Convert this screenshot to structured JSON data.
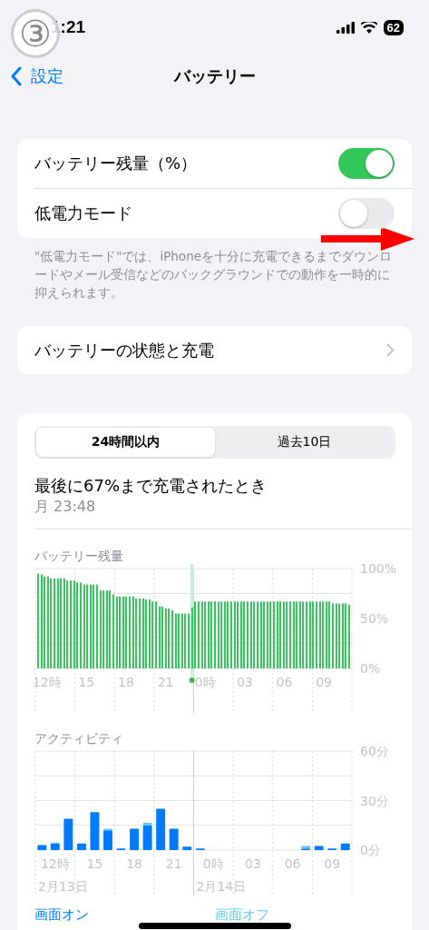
{
  "status_bar": {
    "time": "1:21",
    "battery": "62"
  },
  "annotations": {
    "step_badge": "③",
    "arrow": true
  },
  "nav": {
    "back": "設定",
    "title": "バッテリー"
  },
  "settings": [
    {
      "kind": "toggle",
      "label": "バッテリー残量（%）",
      "on": true
    },
    {
      "kind": "toggle",
      "label": "低電力モード",
      "on": false
    }
  ],
  "footnote": "\"低電力モード\"では、iPhoneを十分に充電できるまでダウンロードやメール受信などのバックグラウンドでの動作を一時的に抑えられます。",
  "health_row": {
    "label": "バッテリーの状態と充電"
  },
  "usage": {
    "tabs": [
      {
        "label": "24時間以内",
        "selected": true
      },
      {
        "label": "過去10日",
        "selected": false
      }
    ],
    "last_charge": {
      "title": "最後に67%まで充電されたとき",
      "time": "月 23:48"
    },
    "battery_chart": {
      "chart_data": {
        "type": "bar",
        "title": "バッテリー残量",
        "values": [
          95,
          94,
          92,
          92,
          90,
          90,
          90,
          90,
          90,
          88,
          88,
          88,
          86,
          86,
          84,
          84,
          84,
          84,
          84,
          78,
          78,
          78,
          78,
          74,
          72,
          72,
          72,
          72,
          72,
          72,
          70,
          70,
          70,
          69,
          69,
          67,
          67,
          62,
          62,
          60,
          60,
          58,
          55,
          55,
          55,
          55,
          55,
          61,
          67,
          67,
          67,
          67,
          67,
          67,
          67,
          67,
          67,
          67,
          67,
          67,
          67,
          67,
          67,
          67,
          67,
          67,
          67,
          67,
          67,
          67,
          67,
          67,
          67,
          67,
          67,
          67,
          67,
          67,
          67,
          67,
          67,
          67,
          67,
          67,
          67,
          67,
          67,
          67,
          67,
          67,
          65,
          65,
          65,
          65,
          65,
          64
        ],
        "categories": [
          null,
          null,
          null,
          "12時",
          null,
          null,
          null,
          null,
          null,
          null,
          null,
          null,
          null,
          null,
          null,
          "15",
          null,
          null,
          null,
          null,
          null,
          null,
          null,
          null,
          null,
          null,
          null,
          "18",
          null,
          null,
          null,
          null,
          null,
          null,
          null,
          null,
          null,
          null,
          null,
          "21",
          null,
          null,
          null,
          null,
          null,
          null,
          null,
          null,
          null,
          null,
          null,
          "0時",
          null,
          null,
          null,
          null,
          null,
          null,
          null,
          null,
          null,
          null,
          null,
          "03",
          null,
          null,
          null,
          null,
          null,
          null,
          null,
          null,
          null,
          null,
          null,
          "06",
          null,
          null,
          null,
          null,
          null,
          null,
          null,
          null,
          null,
          null,
          null,
          "09",
          null,
          null,
          null,
          null,
          null,
          null,
          null,
          null
        ],
        "grid": true,
        "ylim": [
          0,
          100
        ],
        "yticks": [
          {
            "value": 0,
            "label": "0%"
          },
          {
            "value": 50,
            "label": "50%"
          },
          {
            "value": 100,
            "label": "100%"
          }
        ]
      }
    },
    "activity_chart": {
      "chart_data": {
        "type": "bar",
        "title": "アクティビティ",
        "stacked": true,
        "categories": [
          null,
          "12時",
          null,
          null,
          "15",
          null,
          null,
          "18",
          null,
          null,
          "21",
          null,
          null,
          "0時",
          null,
          null,
          "03",
          null,
          null,
          "06",
          null,
          null,
          "09",
          null
        ],
        "series": [
          {
            "name": "画面オン",
            "color": "#007aff",
            "values": [
              3,
              4,
              19,
              4,
              23,
              12,
              1,
              13,
              15,
              25,
              13,
              2,
              1,
              0,
              0,
              0,
              0,
              0,
              0,
              0,
              1,
              2.5,
              1,
              4
            ]
          },
          {
            "name": "画面オフ",
            "color": "#5ac8fa",
            "values": [
              0,
              0.5,
              0,
              0,
              0,
              1,
              0,
              0,
              1.5,
              0,
              0,
              0,
              0,
              0,
              0,
              0,
              0,
              0,
              0,
              0,
              1.5,
              0,
              0,
              0
            ]
          }
        ],
        "grid": true,
        "ylim": [
          0,
          60
        ],
        "yticks": [
          {
            "value": 0,
            "label": "0分"
          },
          {
            "value": 30,
            "label": "30分"
          },
          {
            "value": 60,
            "label": "60分"
          }
        ],
        "annotations": [
          "2月13日",
          "2月14日"
        ]
      }
    }
  }
}
